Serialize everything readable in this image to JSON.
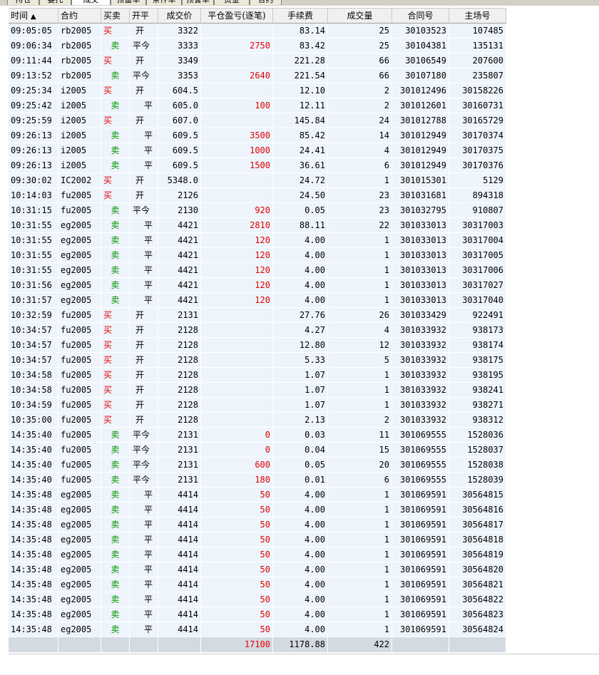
{
  "tabs": [
    "持仓",
    "委托",
    "成交",
    "预备单",
    "条件单",
    "预警单",
    "资金",
    "合约"
  ],
  "active_tab": 2,
  "columns": [
    "时间",
    "合约",
    "买卖",
    "开平",
    "成交价",
    "平仓盈亏(逐笔)",
    "手续费",
    "成交量",
    "合同号",
    "主场号"
  ],
  "sort_indicator": "▲",
  "rows": [
    [
      "09:05:05",
      "rb2005",
      "买",
      "开",
      "3322",
      "",
      "83.14",
      "25",
      "30103523",
      "107485"
    ],
    [
      "09:06:34",
      "rb2005",
      "卖",
      "平今",
      "3333",
      "2750",
      "83.42",
      "25",
      "30104381",
      "135131"
    ],
    [
      "09:11:44",
      "rb2005",
      "买",
      "开",
      "3349",
      "",
      "221.28",
      "66",
      "30106549",
      "207600"
    ],
    [
      "09:13:52",
      "rb2005",
      "卖",
      "平今",
      "3353",
      "2640",
      "221.54",
      "66",
      "30107180",
      "235807"
    ],
    [
      "09:25:34",
      "i2005",
      "买",
      "开",
      "604.5",
      "",
      "12.10",
      "2",
      "301012496",
      "30158226"
    ],
    [
      "09:25:42",
      "i2005",
      "卖",
      "平",
      "605.0",
      "100",
      "12.11",
      "2",
      "301012601",
      "30160731"
    ],
    [
      "09:25:59",
      "i2005",
      "买",
      "开",
      "607.0",
      "",
      "145.84",
      "24",
      "301012788",
      "30165729"
    ],
    [
      "09:26:13",
      "i2005",
      "卖",
      "平",
      "609.5",
      "3500",
      "85.42",
      "14",
      "301012949",
      "30170374"
    ],
    [
      "09:26:13",
      "i2005",
      "卖",
      "平",
      "609.5",
      "1000",
      "24.41",
      "4",
      "301012949",
      "30170375"
    ],
    [
      "09:26:13",
      "i2005",
      "卖",
      "平",
      "609.5",
      "1500",
      "36.61",
      "6",
      "301012949",
      "30170376"
    ],
    [
      "09:30:02",
      "IC2002",
      "买",
      "开",
      "5348.0",
      "",
      "24.72",
      "1",
      "301015301",
      "5129"
    ],
    [
      "10:14:03",
      "fu2005",
      "买",
      "开",
      "2126",
      "",
      "24.50",
      "23",
      "301031681",
      "894318"
    ],
    [
      "10:31:15",
      "fu2005",
      "卖",
      "平今",
      "2130",
      "920",
      "0.05",
      "23",
      "301032795",
      "910807"
    ],
    [
      "10:31:55",
      "eg2005",
      "卖",
      "平",
      "4421",
      "2810",
      "88.11",
      "22",
      "301033013",
      "30317003"
    ],
    [
      "10:31:55",
      "eg2005",
      "卖",
      "平",
      "4421",
      "120",
      "4.00",
      "1",
      "301033013",
      "30317004"
    ],
    [
      "10:31:55",
      "eg2005",
      "卖",
      "平",
      "4421",
      "120",
      "4.00",
      "1",
      "301033013",
      "30317005"
    ],
    [
      "10:31:55",
      "eg2005",
      "卖",
      "平",
      "4421",
      "120",
      "4.00",
      "1",
      "301033013",
      "30317006"
    ],
    [
      "10:31:56",
      "eg2005",
      "卖",
      "平",
      "4421",
      "120",
      "4.00",
      "1",
      "301033013",
      "30317027"
    ],
    [
      "10:31:57",
      "eg2005",
      "卖",
      "平",
      "4421",
      "120",
      "4.00",
      "1",
      "301033013",
      "30317040"
    ],
    [
      "10:32:59",
      "fu2005",
      "买",
      "开",
      "2131",
      "",
      "27.76",
      "26",
      "301033429",
      "922491"
    ],
    [
      "10:34:57",
      "fu2005",
      "买",
      "开",
      "2128",
      "",
      "4.27",
      "4",
      "301033932",
      "938173"
    ],
    [
      "10:34:57",
      "fu2005",
      "买",
      "开",
      "2128",
      "",
      "12.80",
      "12",
      "301033932",
      "938174"
    ],
    [
      "10:34:57",
      "fu2005",
      "买",
      "开",
      "2128",
      "",
      "5.33",
      "5",
      "301033932",
      "938175"
    ],
    [
      "10:34:58",
      "fu2005",
      "买",
      "开",
      "2128",
      "",
      "1.07",
      "1",
      "301033932",
      "938195"
    ],
    [
      "10:34:58",
      "fu2005",
      "买",
      "开",
      "2128",
      "",
      "1.07",
      "1",
      "301033932",
      "938241"
    ],
    [
      "10:34:59",
      "fu2005",
      "买",
      "开",
      "2128",
      "",
      "1.07",
      "1",
      "301033932",
      "938271"
    ],
    [
      "10:35:00",
      "fu2005",
      "买",
      "开",
      "2128",
      "",
      "2.13",
      "2",
      "301033932",
      "938312"
    ],
    [
      "14:35:40",
      "fu2005",
      "卖",
      "平今",
      "2131",
      "0",
      "0.03",
      "11",
      "301069555",
      "1528036"
    ],
    [
      "14:35:40",
      "fu2005",
      "卖",
      "平今",
      "2131",
      "0",
      "0.04",
      "15",
      "301069555",
      "1528037"
    ],
    [
      "14:35:40",
      "fu2005",
      "卖",
      "平今",
      "2131",
      "600",
      "0.05",
      "20",
      "301069555",
      "1528038"
    ],
    [
      "14:35:40",
      "fu2005",
      "卖",
      "平今",
      "2131",
      "180",
      "0.01",
      "6",
      "301069555",
      "1528039"
    ],
    [
      "14:35:48",
      "eg2005",
      "卖",
      "平",
      "4414",
      "50",
      "4.00",
      "1",
      "301069591",
      "30564815"
    ],
    [
      "14:35:48",
      "eg2005",
      "卖",
      "平",
      "4414",
      "50",
      "4.00",
      "1",
      "301069591",
      "30564816"
    ],
    [
      "14:35:48",
      "eg2005",
      "卖",
      "平",
      "4414",
      "50",
      "4.00",
      "1",
      "301069591",
      "30564817"
    ],
    [
      "14:35:48",
      "eg2005",
      "卖",
      "平",
      "4414",
      "50",
      "4.00",
      "1",
      "301069591",
      "30564818"
    ],
    [
      "14:35:48",
      "eg2005",
      "卖",
      "平",
      "4414",
      "50",
      "4.00",
      "1",
      "301069591",
      "30564819"
    ],
    [
      "14:35:48",
      "eg2005",
      "卖",
      "平",
      "4414",
      "50",
      "4.00",
      "1",
      "301069591",
      "30564820"
    ],
    [
      "14:35:48",
      "eg2005",
      "卖",
      "平",
      "4414",
      "50",
      "4.00",
      "1",
      "301069591",
      "30564821"
    ],
    [
      "14:35:48",
      "eg2005",
      "卖",
      "平",
      "4414",
      "50",
      "4.00",
      "1",
      "301069591",
      "30564822"
    ],
    [
      "14:35:48",
      "eg2005",
      "卖",
      "平",
      "4414",
      "50",
      "4.00",
      "1",
      "301069591",
      "30564823"
    ],
    [
      "14:35:48",
      "eg2005",
      "卖",
      "平",
      "4414",
      "50",
      "4.00",
      "1",
      "301069591",
      "30564824"
    ]
  ],
  "totals": {
    "pnl": "17100",
    "fee": "1178.88",
    "volume": "422"
  },
  "colors": {
    "buy": "#e00000",
    "sell": "#009000",
    "pnl": "#e00000",
    "row_bg": "#eef4fb"
  }
}
